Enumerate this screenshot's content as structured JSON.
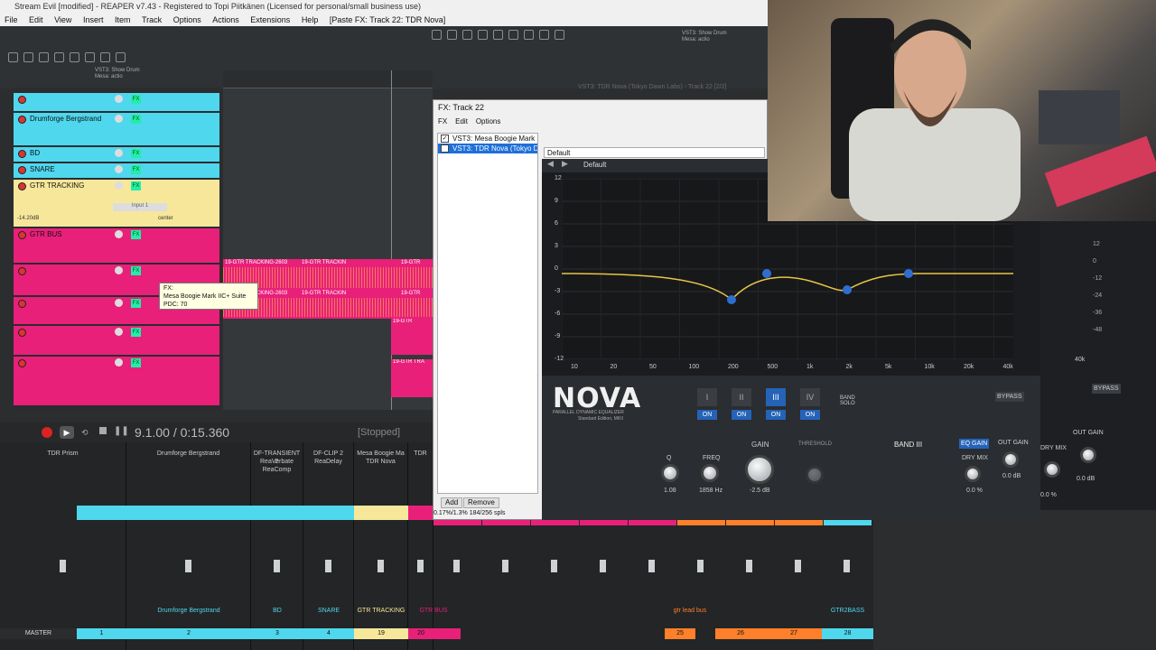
{
  "window": {
    "title": "Stream Evil [modified] - REAPER v7.43 - Registered to Topi Piitkänen (Licensed for personal/small business use)"
  },
  "menu": [
    "File",
    "Edit",
    "View",
    "Insert",
    "Item",
    "Track",
    "Options",
    "Actions",
    "Extensions",
    "Help",
    "[Paste FX: Track 22: TDR Nova]"
  ],
  "toolbar": {
    "vst_label": "VST3: Show Drum Mesa: actio"
  },
  "tracks": [
    {
      "name": "",
      "color": "#4fd7ee",
      "num": "1"
    },
    {
      "name": "Drumforge Bergstrand",
      "color": "#4fd7ee",
      "num": ""
    },
    {
      "name": "BD",
      "color": "#4fd7ee",
      "num": ""
    },
    {
      "name": "SNARE",
      "color": "#4fd7ee",
      "num": ""
    },
    {
      "name": "GTR TRACKING",
      "color": "#f7e79a",
      "num": "19",
      "vol": "-14.20dB",
      "pan": "center",
      "input": "Input 1"
    },
    {
      "name": "GTR BUS",
      "color": "#e8207a",
      "num": ""
    },
    {
      "name": "",
      "color": "#e8207a",
      "num": ""
    },
    {
      "name": "",
      "color": "#e8207a",
      "num": ""
    },
    {
      "name": "",
      "color": "#e8207a",
      "num": ""
    },
    {
      "name": "",
      "color": "#e8207a",
      "num": ""
    }
  ],
  "tooltip": {
    "line1": "FX:",
    "line2": "Mesa Boogie Mark IIC+ Suite",
    "line3": "PDC: 70"
  },
  "clips": [
    "19-GTR TRACKING-2603",
    "19-GTR TRACKIN",
    "19-GTR",
    "19-GTR TRACKING-2603",
    "19-GTR TRACKIN",
    "19-GTR",
    "19-GTR",
    "19-GTR TRA"
  ],
  "transport": {
    "time": "9.1.00 / 0:15.360",
    "status": "[Stopped]"
  },
  "mixer_strips": [
    {
      "name": "TDR Prism",
      "fx": ""
    },
    {
      "name": "Drumforge Bergstrand",
      "fx": ""
    },
    {
      "name": "DF-TRANSIENT 2",
      "fx": "ReaVerbate ReaComp"
    },
    {
      "name": "DF-CLIP 2",
      "fx": "ReaDelay"
    },
    {
      "name": "Mesa Boogie Ma",
      "fx": "TDR Nova"
    },
    {
      "name": "TDR",
      "fx": ""
    }
  ],
  "mixer_bottom": [
    {
      "label": "MASTER",
      "color": "#2a2c2e"
    },
    {
      "label": "1",
      "color": "#4fd7ee"
    },
    {
      "label": "2",
      "color": "#4fd7ee"
    },
    {
      "label": "3",
      "color": "#4fd7ee"
    },
    {
      "label": "4",
      "color": "#4fd7ee"
    },
    {
      "label": "19",
      "color": "#f7e79a"
    },
    {
      "label": "20",
      "color": "#e8207a"
    },
    {
      "label": "",
      "color": "#e8207a"
    },
    {
      "label": "25",
      "color": "#ff7f2a"
    },
    {
      "label": "26",
      "color": "#ff7f2a"
    },
    {
      "label": "27",
      "color": "#ff7f2a"
    },
    {
      "label": "28",
      "color": "#4fd7ee"
    }
  ],
  "mixer_names": {
    "drum": "Drumforge Bergstrand",
    "bd": "BD",
    "snare": "SNARE",
    "gtr": "GTR TRACKING",
    "bus": "GTR BUS",
    "lead": "gtr lead bus",
    "bass": "GTR2BASS"
  },
  "fx_window": {
    "title": "FX: Track 22",
    "menu": [
      "FX",
      "Edit",
      "Options"
    ],
    "items": [
      {
        "name": "VST3: Mesa Boogie Mark II...",
        "enabled": true,
        "selected": false
      },
      {
        "name": "VST3: TDR Nova (Tokyo D...",
        "enabled": true,
        "selected": true
      }
    ],
    "add": "Add",
    "remove": "Remove",
    "stats": "0.17%/1.3% 184/256 spls",
    "preset": "Default",
    "plugin_title": "VST3: TDR Nova (Tokyo Dawn Labs) - Track 22 [2/2]"
  },
  "nova": {
    "logo": "NOVA",
    "subtitle": "PARALLEL DYNAMIC EQUALIZER",
    "edition": "Standard Edition, MKII",
    "preset": "Default",
    "bands": [
      "I",
      "II",
      "III",
      "IV"
    ],
    "on": "ON",
    "band_solo": "BAND SOLO",
    "bypass": "BYPASS",
    "gain_label": "GAIN",
    "threshold": "THRESHOLD",
    "band_label": "BAND III",
    "eq_gain": "EQ GAIN",
    "out_gain": "OUT GAIN",
    "dry_mix": "DRY MIX",
    "q_label": "Q",
    "freq_label": "FREQ",
    "q_val": "1.08",
    "freq_val": "1858 Hz",
    "gain_val": "-2.5 dB",
    "dry_val": "0.0 %",
    "out_val": "0.0 dB",
    "y_labels": [
      "12",
      "9",
      "6",
      "3",
      "0",
      "-3",
      "-6",
      "-9",
      "-12"
    ],
    "x_labels": [
      "10",
      "20",
      "50",
      "100",
      "200",
      "500",
      "1k",
      "2k",
      "5k",
      "10k",
      "20k",
      "40k"
    ]
  },
  "right_scale": [
    "12",
    "0",
    "-12",
    "-24",
    "-36",
    "-48"
  ],
  "right_panel": {
    "bypass": "BYPASS",
    "out_gain": "OUT GAIN",
    "dry_mix": "DRY MIX",
    "out_val": "0.0 dB",
    "dry_val": "0.0 %",
    "freq": "40k"
  }
}
